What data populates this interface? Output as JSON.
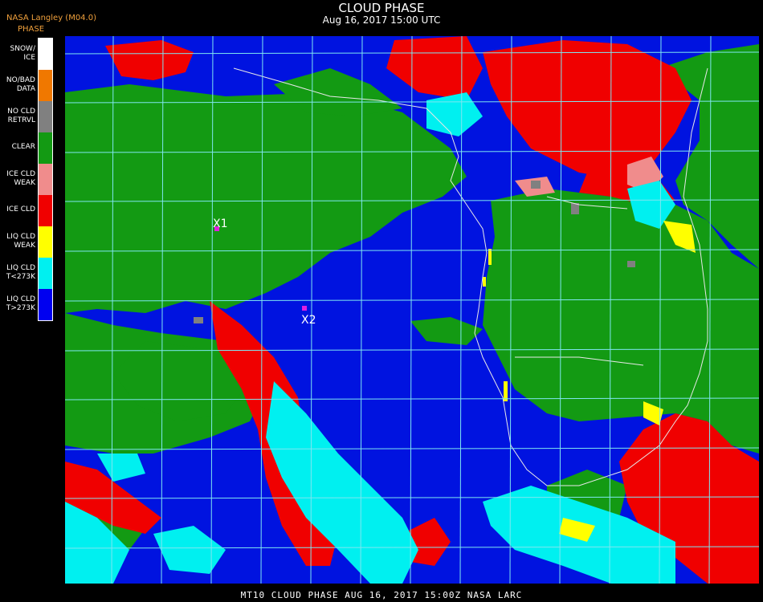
{
  "header": {
    "title": "CLOUD PHASE",
    "subtitle": "Aug 16, 2017 15:00 UTC",
    "product": "NASA Langley (M04.0)",
    "legend_title": "PHASE"
  },
  "legend": [
    {
      "label": "SNOW/\nICE",
      "color": "#ffffff"
    },
    {
      "label": "NO/BAD\nDATA",
      "color": "#f07800"
    },
    {
      "label": "NO CLD\nRETRVL",
      "color": "#808080"
    },
    {
      "label": "CLEAR",
      "color": "#139a13"
    },
    {
      "label": "ICE CLD\nWEAK",
      "color": "#f08c8c"
    },
    {
      "label": "ICE CLD",
      "color": "#f00000"
    },
    {
      "label": "LIQ CLD\nWEAK",
      "color": "#ffff00"
    },
    {
      "label": "LIQ CLD\nT<273K",
      "color": "#00f0f0"
    },
    {
      "label": "LIQ CLD\nT>273K",
      "color": "#0000f0"
    }
  ],
  "markers": [
    {
      "label": "X1"
    },
    {
      "label": "X2"
    }
  ],
  "footer": "MT10  CLOUD PHASE   AUG 16, 2017 15:00Z   NASA LARC",
  "colors": {
    "water": "#0013e0",
    "clear": "#139a13",
    "ice": "#f00000",
    "liquid_cold": "#00f0f0",
    "grid": "#7fe6f0",
    "marker": "#e020e0"
  }
}
